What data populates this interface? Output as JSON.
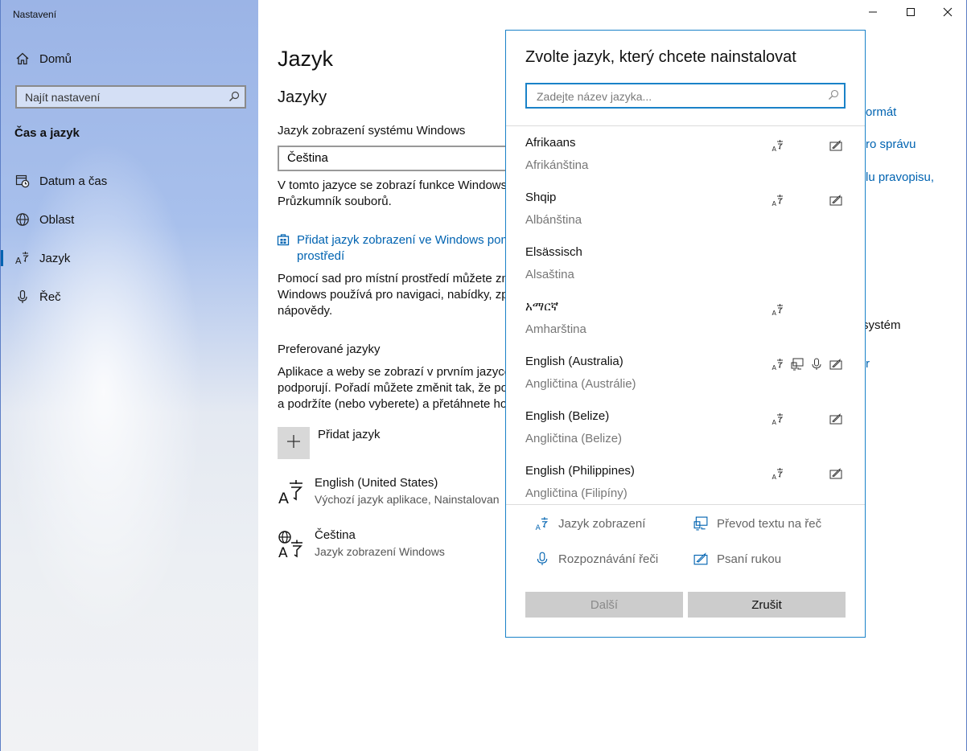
{
  "window": {
    "title": "Nastavení"
  },
  "sidebar": {
    "home_label": "Domů",
    "search_placeholder": "Najít nastavení",
    "section_title": "Čas a jazyk",
    "items": [
      {
        "label": "Datum a čas",
        "icon": "calendar-clock-icon"
      },
      {
        "label": "Oblast",
        "icon": "globe-icon"
      },
      {
        "label": "Jazyk",
        "icon": "language-icon",
        "selected": true
      },
      {
        "label": "Řeč",
        "icon": "microphone-icon"
      }
    ]
  },
  "main": {
    "page_title": "Jazyk",
    "languages_heading": "Jazyky",
    "display_lang_label": "Jazyk zobrazení systému Windows",
    "display_lang_value": "Čeština",
    "display_desc_line1": "V tomto jazyce se zobrazí funkce Windows,",
    "display_desc_line2": "Průzkumník souborů.",
    "add_display_link_line1": "Přidat jazyk zobrazení ve Windows pom",
    "add_display_link_line2": "prostředí",
    "pack_desc_line1": "Pomocí sad pro místní prostředí můžete zm",
    "pack_desc_line2": "Windows používá pro navigaci, nabídky, zp",
    "pack_desc_line3": "nápovědy.",
    "preferred_heading": "Preferované jazyky",
    "preferred_desc_line1": "Aplikace a weby se zobrazí v prvním jazyce",
    "preferred_desc_line2": "podporují. Pořadí můžete změnit tak, že po",
    "preferred_desc_line3": "a podržíte (nebo vyberete) a přetáhnete ho",
    "add_language_label": "Přidat jazyk",
    "installed": [
      {
        "name": "English (United States)",
        "desc": "Výchozí jazyk aplikace, Nainstalovan"
      },
      {
        "name": "Čeština",
        "desc": "Jazyk zobrazení Windows"
      }
    ],
    "right_links": [
      "ormát",
      "ro správu",
      "lu pravopisu,"
    ],
    "right_text_1": "systém",
    "right_text_2": "r"
  },
  "dialog": {
    "title": "Zvolte jazyk, který chcete nainstalovat",
    "search_placeholder": "Zadejte název jazyka...",
    "languages": [
      {
        "name": "Afrikaans",
        "local": "Afrikánština",
        "features": [
          "display",
          "handwriting"
        ]
      },
      {
        "name": "Shqip",
        "local": "Albánština",
        "features": [
          "display",
          "handwriting"
        ]
      },
      {
        "name": "Elsässisch",
        "local": "Alsaština",
        "features": []
      },
      {
        "name": "አማርኛ",
        "local": "Amharština",
        "features": [
          "display"
        ]
      },
      {
        "name": "English (Australia)",
        "local": "Angličtina (Austrálie)",
        "features": [
          "display",
          "tts",
          "speech",
          "handwriting"
        ]
      },
      {
        "name": "English (Belize)",
        "local": "Angličtina (Belize)",
        "features": [
          "display",
          "handwriting"
        ]
      },
      {
        "name": "English (Philippines)",
        "local": "Angličtina (Filipíny)",
        "features": [
          "display",
          "handwriting"
        ]
      }
    ],
    "legend": {
      "display": "Jazyk zobrazení",
      "tts": "Převod textu na řeč",
      "speech": "Rozpoznávání řeči",
      "handwriting": "Psaní rukou"
    },
    "next_label": "Další",
    "cancel_label": "Zrušit"
  },
  "colors": {
    "accent": "#0063b1",
    "dialog_border": "#1a82c8",
    "button_bg": "#cccccc"
  }
}
